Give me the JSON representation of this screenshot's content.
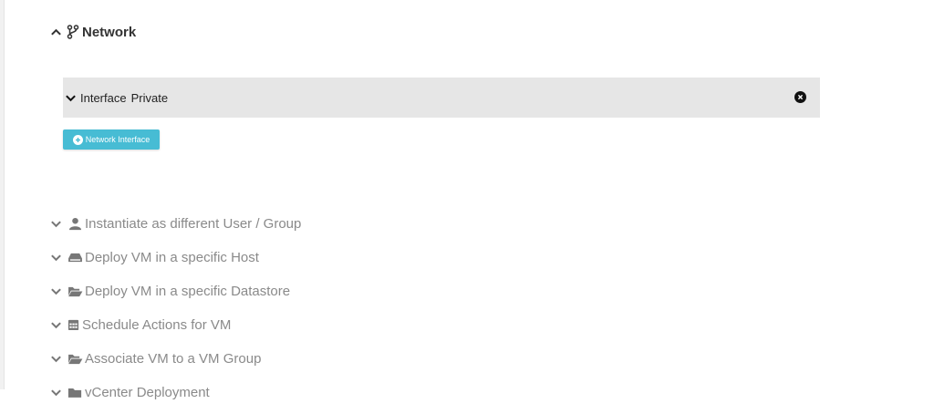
{
  "network": {
    "title": "Network",
    "interface": {
      "label": "Interface",
      "value": "Private"
    },
    "add_button": "Network Interface"
  },
  "advanced": {
    "items": [
      {
        "label": "Instantiate as different User / Group",
        "icon": "user-icon"
      },
      {
        "label": "Deploy VM in a specific Host",
        "icon": "hdd-icon"
      },
      {
        "label": "Deploy VM in a specific Datastore",
        "icon": "folder-open-icon"
      },
      {
        "label": "Schedule Actions for VM",
        "icon": "calendar-icon"
      },
      {
        "label": "Associate VM to a VM Group",
        "icon": "folder-open-icon"
      },
      {
        "label": "vCenter Deployment",
        "icon": "folder-icon"
      }
    ]
  },
  "colors": {
    "accent": "#47bcd4",
    "interface_bg": "#e6e6e6",
    "muted_text": "#8a8a8a"
  }
}
